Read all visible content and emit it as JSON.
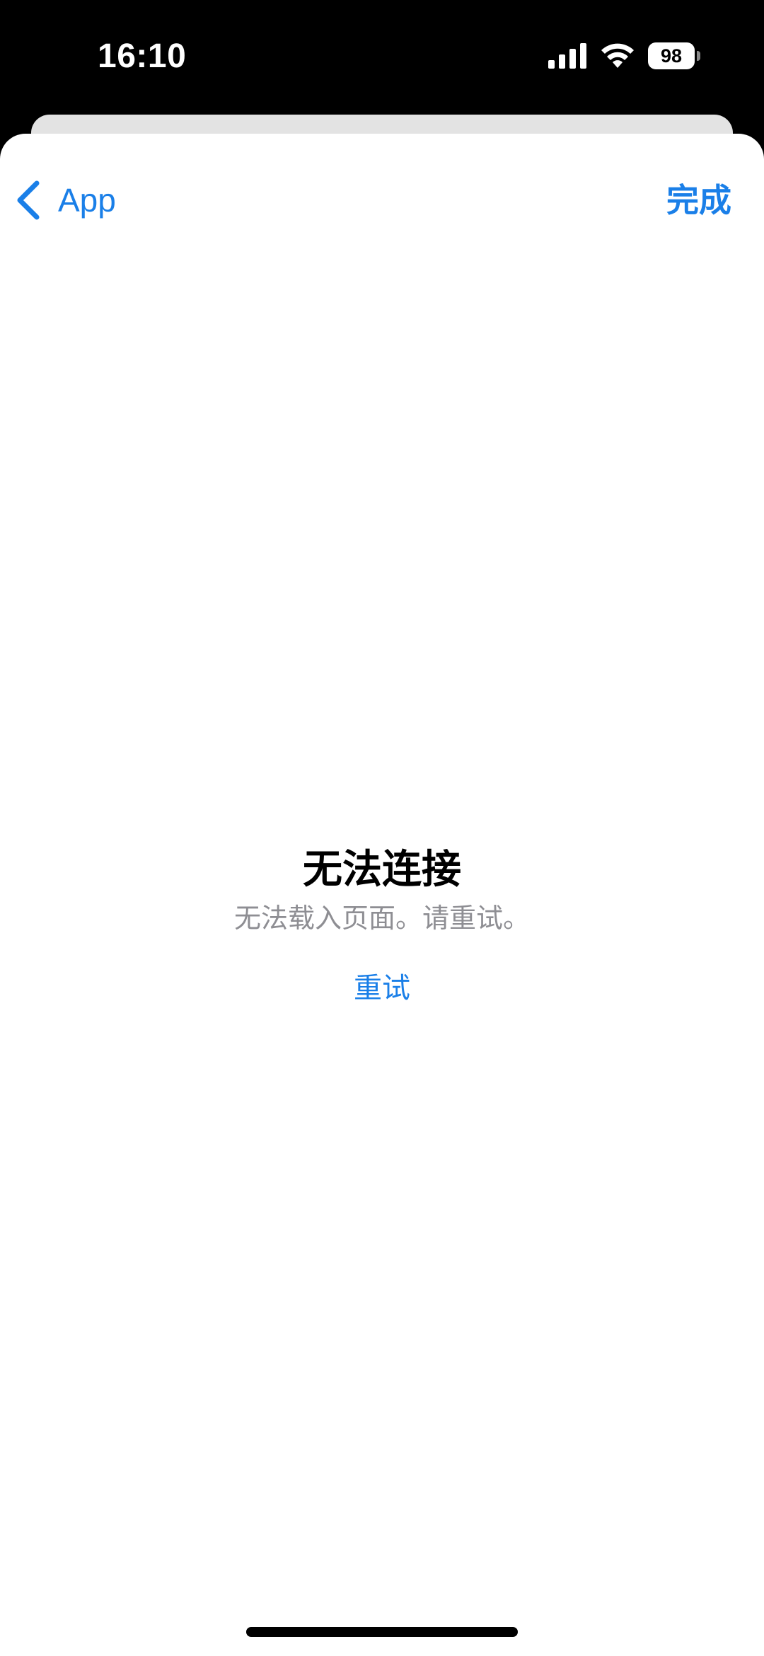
{
  "status_bar": {
    "time": "16:10",
    "battery_level": "98",
    "icons": [
      "signal-icon",
      "wifi-icon",
      "battery-icon"
    ]
  },
  "nav": {
    "back_label": "App",
    "done_label": "完成"
  },
  "error": {
    "title": "无法连接",
    "message": "无法载入页面。请重试。",
    "retry_label": "重试"
  },
  "colors": {
    "accent": "#1a7fe8",
    "secondary_text": "#8e8e93",
    "sheet_behind": "#e3e3e3"
  }
}
